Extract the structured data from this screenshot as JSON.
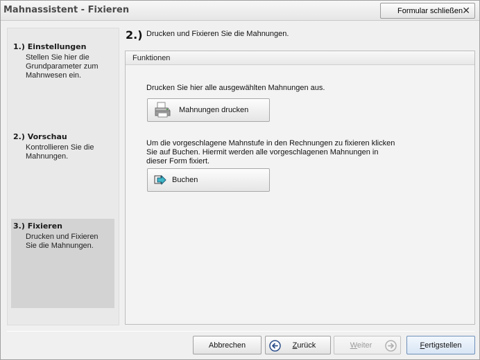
{
  "window": {
    "title": "Mahnassistent - Fixieren",
    "close_form_label": "Formular schließen",
    "close_symbol": "✕"
  },
  "steps": [
    {
      "title": "1.) Einstellungen",
      "desc": "Stellen Sie hier die Grundparameter zum Mahnwesen ein.",
      "active": false
    },
    {
      "title": "2.) Vorschau",
      "desc": "Kontrollieren Sie die Mahnungen.",
      "active": false
    },
    {
      "title": "3.) Fixieren",
      "desc": "Drucken und Fixieren Sie die Mahnungen.",
      "active": true
    }
  ],
  "main": {
    "step_number": "2.)",
    "heading": "Drucken und Fixieren Sie die Mahnungen.",
    "group_title": "Funktionen",
    "print_info": "Drucken Sie hier alle ausgewählten Mahnungen aus.",
    "print_button": "Mahnungen drucken",
    "book_info_line1": "Um die vorgeschlagene Mahnstufe in den Rechnungen zu fixieren klicken",
    "book_info_line2": "Sie auf Buchen. Hiermit werden alle vorgeschlagenen Mahnungen in",
    "book_info_line3": "dieser Form fixiert.",
    "book_button": "Buchen"
  },
  "footer": {
    "cancel": "Abbrechen",
    "back_first": "Z",
    "back_rest": "urück",
    "next_first": "W",
    "next_rest": "eiter",
    "finish_first": "F",
    "finish_rest": "ertigstellen"
  },
  "colors": {
    "active_step_bg": "#d3d3d3",
    "panel_bg": "#e9e9e9",
    "nav_icon": "#2b4f8a"
  }
}
